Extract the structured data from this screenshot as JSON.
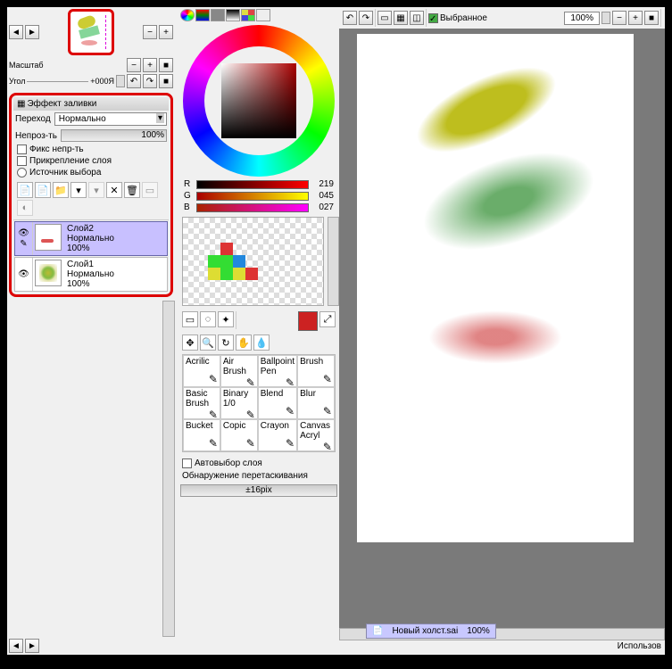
{
  "nav": {
    "zoom_label": "Масштаб",
    "angle_label": "Угол",
    "angle_value": "+000Я"
  },
  "fill": {
    "title": "Эффект заливки",
    "blend_label": "Переход",
    "blend_value": "Нормально",
    "opacity_label": "Непроз-ть",
    "opacity_value": "100%",
    "fix_opacity": "Фикс непр-ть",
    "attach_layer": "Прикрепление слоя",
    "selection_source": "Источник выбора"
  },
  "layers": [
    {
      "name": "Слой2",
      "mode": "Нормально",
      "opacity": "100%",
      "selected": true
    },
    {
      "name": "Слой1",
      "mode": "Нормально",
      "opacity": "100%",
      "selected": false
    }
  ],
  "rgb": {
    "r": "219",
    "g": "045",
    "b": "027"
  },
  "brushes": [
    "Acrilic",
    "Air Brush",
    "Ballpoint Pen",
    "Brush",
    "Basic Brush",
    "Binary 1/0",
    "Blend",
    "Blur",
    "Bucket",
    "Copic",
    "Crayon",
    "Canvas Acryl"
  ],
  "auto_select": "Автовыбор слоя",
  "drag_detect": "Обнаружение перетаскивания",
  "drag_value": "±16pix",
  "canvas_toolbar": {
    "selected": "Выбранное",
    "zoom": "100%"
  },
  "doc": {
    "name": "Новый холст.sai",
    "zoom": "100%"
  },
  "status": "Использов",
  "rgb_labels": {
    "r": "R",
    "g": "G",
    "b": "B"
  }
}
